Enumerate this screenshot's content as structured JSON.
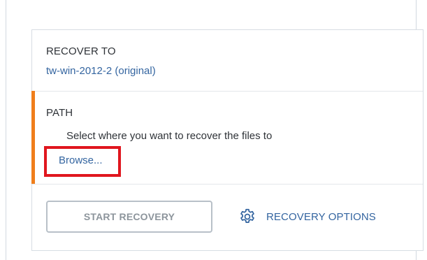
{
  "recover_to": {
    "label": "RECOVER TO",
    "value": "tw-win-2012-2 (original)"
  },
  "path": {
    "label": "PATH",
    "hint": "Select where you want to recover the files to",
    "browse_label": "Browse..."
  },
  "actions": {
    "start_label": "START RECOVERY",
    "options_label": "RECOVERY OPTIONS",
    "options_icon": "gear-icon"
  },
  "colors": {
    "accent": "#f07e1b",
    "link": "#3465a0",
    "highlight": "#e0161e",
    "disabled_text": "#8d959c"
  }
}
